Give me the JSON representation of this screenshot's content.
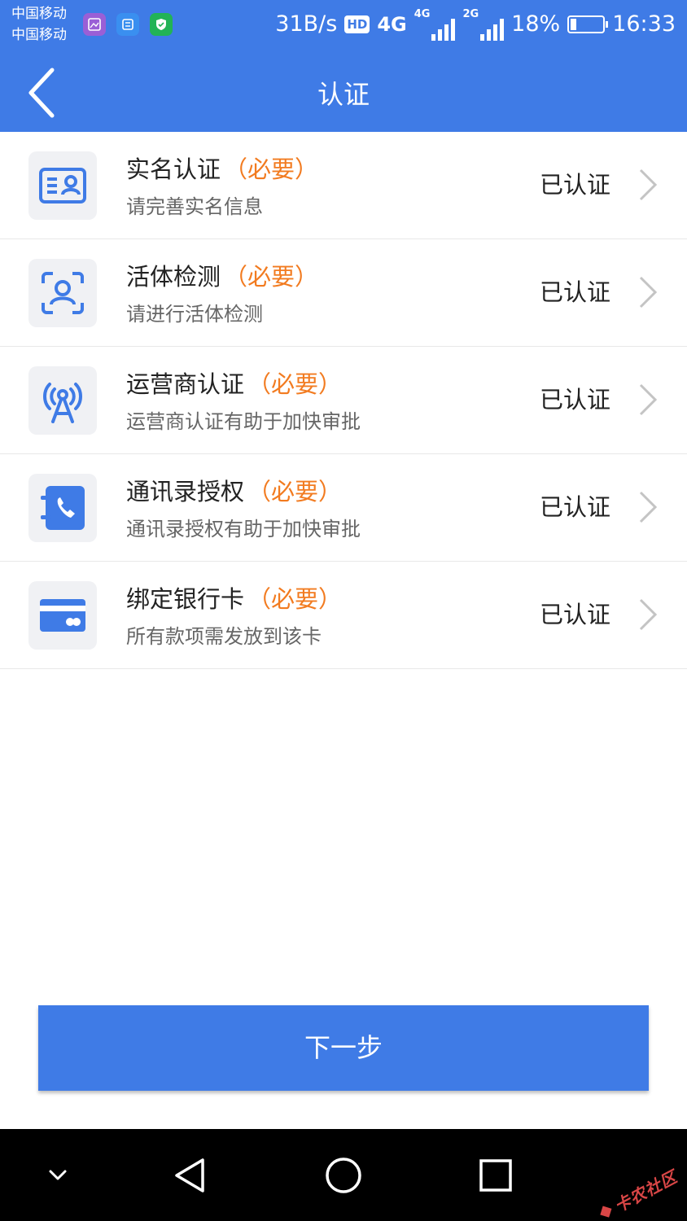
{
  "status_bar": {
    "carrier_1": "中国移动",
    "carrier_2": "中国移动",
    "net_speed": "31B/s",
    "hd_label": "HD",
    "net_4g": "4G",
    "net_4g_small": "4G",
    "net_2g_small": "2G",
    "battery_percent": "18%",
    "battery_level": 0.18,
    "time": "16:33"
  },
  "header": {
    "title": "认证",
    "back_icon": "chevron-left-icon"
  },
  "items": [
    {
      "title": "实名认证",
      "tag": "（必要）",
      "description": "请完善实名信息",
      "status": "已认证",
      "icon": "id-card-icon"
    },
    {
      "title": "活体检测",
      "tag": "（必要）",
      "description": "请进行活体检测",
      "status": "已认证",
      "icon": "face-scan-icon"
    },
    {
      "title": "运营商认证",
      "tag": "（必要）",
      "description": "运营商认证有助于加快审批",
      "status": "已认证",
      "icon": "signal-tower-icon"
    },
    {
      "title": "通讯录授权",
      "tag": "（必要）",
      "description": "通讯录授权有助于加快审批",
      "status": "已认证",
      "icon": "contacts-phone-icon"
    },
    {
      "title": "绑定银行卡",
      "tag": "（必要）",
      "description": "所有款项需发放到该卡",
      "status": "已认证",
      "icon": "bank-card-icon"
    }
  ],
  "next_button": {
    "label": "下一步"
  },
  "watermark": {
    "text": "卡农社区"
  },
  "colors": {
    "primary": "#3f7be6",
    "required_tag": "#f27b20",
    "icon_bg": "#f0f1f4",
    "icon_fg": "#3f7be6"
  }
}
